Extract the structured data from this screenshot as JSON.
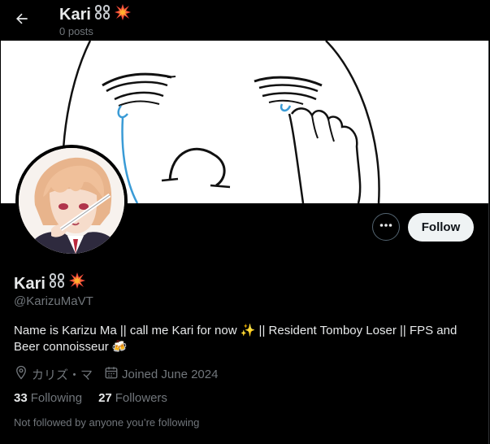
{
  "header": {
    "title": "Kari",
    "posts_count": "0 posts"
  },
  "profile": {
    "display_name": "Kari",
    "handle": "@KarizuMaVT",
    "bio": "Name is Karizu Ma || call me Kari for now ✨ || Resident Tomboy Loser || FPS and Beer connoisseur 🍻",
    "location": "カリズ・マ",
    "joined": "Joined June 2024",
    "following_count": "33",
    "following_label": "Following",
    "followers_count": "27",
    "followers_label": "Followers",
    "followed_by_note": "Not followed by anyone you’re following"
  },
  "actions": {
    "follow_label": "Follow"
  },
  "icons": {
    "back": "back-arrow-icon",
    "more": "more-dots-icon",
    "location": "location-pin-icon",
    "calendar": "calendar-icon",
    "name_badges": [
      "chains-emoji",
      "collision-emoji"
    ]
  },
  "colors": {
    "background": "#000000",
    "primary_text": "#e7e9ea",
    "secondary_text": "#71767b",
    "follow_button_bg": "#eff3f4",
    "follow_button_text": "#0f1419",
    "banner_bg": "#ffffff",
    "tear_blue": "#3a9bd6"
  }
}
